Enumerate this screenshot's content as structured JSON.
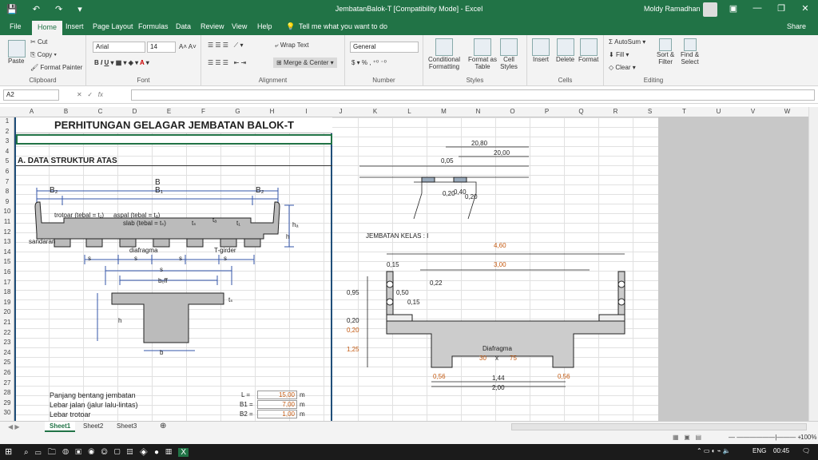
{
  "titlebar": {
    "title": "JembatanBalok-T  [Compatibility Mode]  -  Excel",
    "user": "Moldy Ramadhan",
    "minimize": "—",
    "restore": "❐",
    "close": "✕",
    "ribbon_opts": "▣"
  },
  "tabs": [
    "File",
    "Home",
    "Insert",
    "Page Layout",
    "Formulas",
    "Data",
    "Review",
    "View",
    "Help"
  ],
  "tell_me": "Tell me what you want to do",
  "share": "Share",
  "ribbon": {
    "clipboard": {
      "label": "Clipboard",
      "paste": "Paste",
      "cut": "Cut",
      "copy": "Copy",
      "painter": "Format Painter"
    },
    "font": {
      "label": "Font",
      "name": "Arial",
      "size": "14"
    },
    "alignment": {
      "label": "Alignment",
      "wrap": "Wrap Text",
      "merge": "Merge & Center"
    },
    "number": {
      "label": "Number",
      "format": "General"
    },
    "styles": {
      "label": "Styles",
      "cond": "Conditional\nFormatting",
      "table": "Format as\nTable",
      "cell": "Cell\nStyles"
    },
    "cells": {
      "label": "Cells",
      "insert": "Insert",
      "delete": "Delete",
      "format": "Format"
    },
    "editing": {
      "label": "Editing",
      "autosum": "AutoSum",
      "fill": "Fill",
      "clear": "Clear",
      "sort": "Sort &\nFilter",
      "find": "Find &\nSelect"
    }
  },
  "namebox": "A2",
  "fx": "fx",
  "columns": [
    "A",
    "B",
    "C",
    "D",
    "E",
    "F",
    "G",
    "H",
    "I",
    "J",
    "K",
    "L",
    "M",
    "N",
    "O",
    "P",
    "Q",
    "R",
    "S",
    "T",
    "U",
    "V",
    "W"
  ],
  "rows": [
    "1",
    "2",
    "3",
    "4",
    "5",
    "6",
    "7",
    "8",
    "9",
    "10",
    "11",
    "12",
    "13",
    "14",
    "15",
    "16",
    "17",
    "18",
    "19",
    "20",
    "21",
    "22",
    "23",
    "24",
    "25",
    "26",
    "27",
    "28",
    "29",
    "30"
  ],
  "sheet": {
    "title": "PERHITUNGAN GELAGAR JEMBATAN BALOK-T",
    "section": "A. DATA STRUKTUR ATAS",
    "labels": {
      "B": "B",
      "B2l": "B₂",
      "B1": "B₁",
      "B2r": "B₂",
      "trotoar": "trotoar (tebal = t₁)",
      "aspal": "aspal (tebal = tₐ)",
      "slab": "slab (tebal = tₛ)",
      "ts": "tₛ",
      "ta": "tₐ",
      "t1": "t₁",
      "ha": "hₐ",
      "h": "h",
      "sandaran": "sandaran",
      "diafragma": "diafragma",
      "tgirder": "T-girder",
      "s": "s",
      "beff": "bₑff",
      "tsb": "tₛ",
      "hb": "h",
      "b": "b"
    },
    "params": [
      {
        "label": "Panjang bentang jembatan",
        "sym": "L =",
        "val": "15,00",
        "unit": "m"
      },
      {
        "label": "Lebar jalan (jalur lalu-lintas)",
        "sym": "B1 =",
        "val": "7,00",
        "unit": "m"
      },
      {
        "label": "Lebar trotoar",
        "sym": "B2 =",
        "val": "1,00",
        "unit": "m"
      }
    ]
  },
  "right": {
    "d1": "20,80",
    "d2": "20,00",
    "d3": "0,05",
    "d4": "0,20",
    "d5": "0,40",
    "d6": "0,20",
    "kelas": "JEMBATAN  KELAS   :    I",
    "w460": "4,60",
    "w015": "0,15",
    "w300": "3,00",
    "w022": "0,22",
    "w050": "0,50",
    "w015b": "0,15",
    "h095": "0,95",
    "h020": "0,20",
    "h020b": "0,20",
    "h125": "1,25",
    "diaf": "Diafragma",
    "diaf2": "30",
    "diaf3": "x",
    "diaf4": "75",
    "b056": "0,56",
    "b144": "1,44",
    "b056b": "0,56",
    "b200": "2,00"
  },
  "sheets": [
    "Sheet1",
    "Sheet2",
    "Sheet3"
  ],
  "zoom": "100%",
  "taskbar": {
    "lang": "ENG",
    "time": "00:45"
  }
}
